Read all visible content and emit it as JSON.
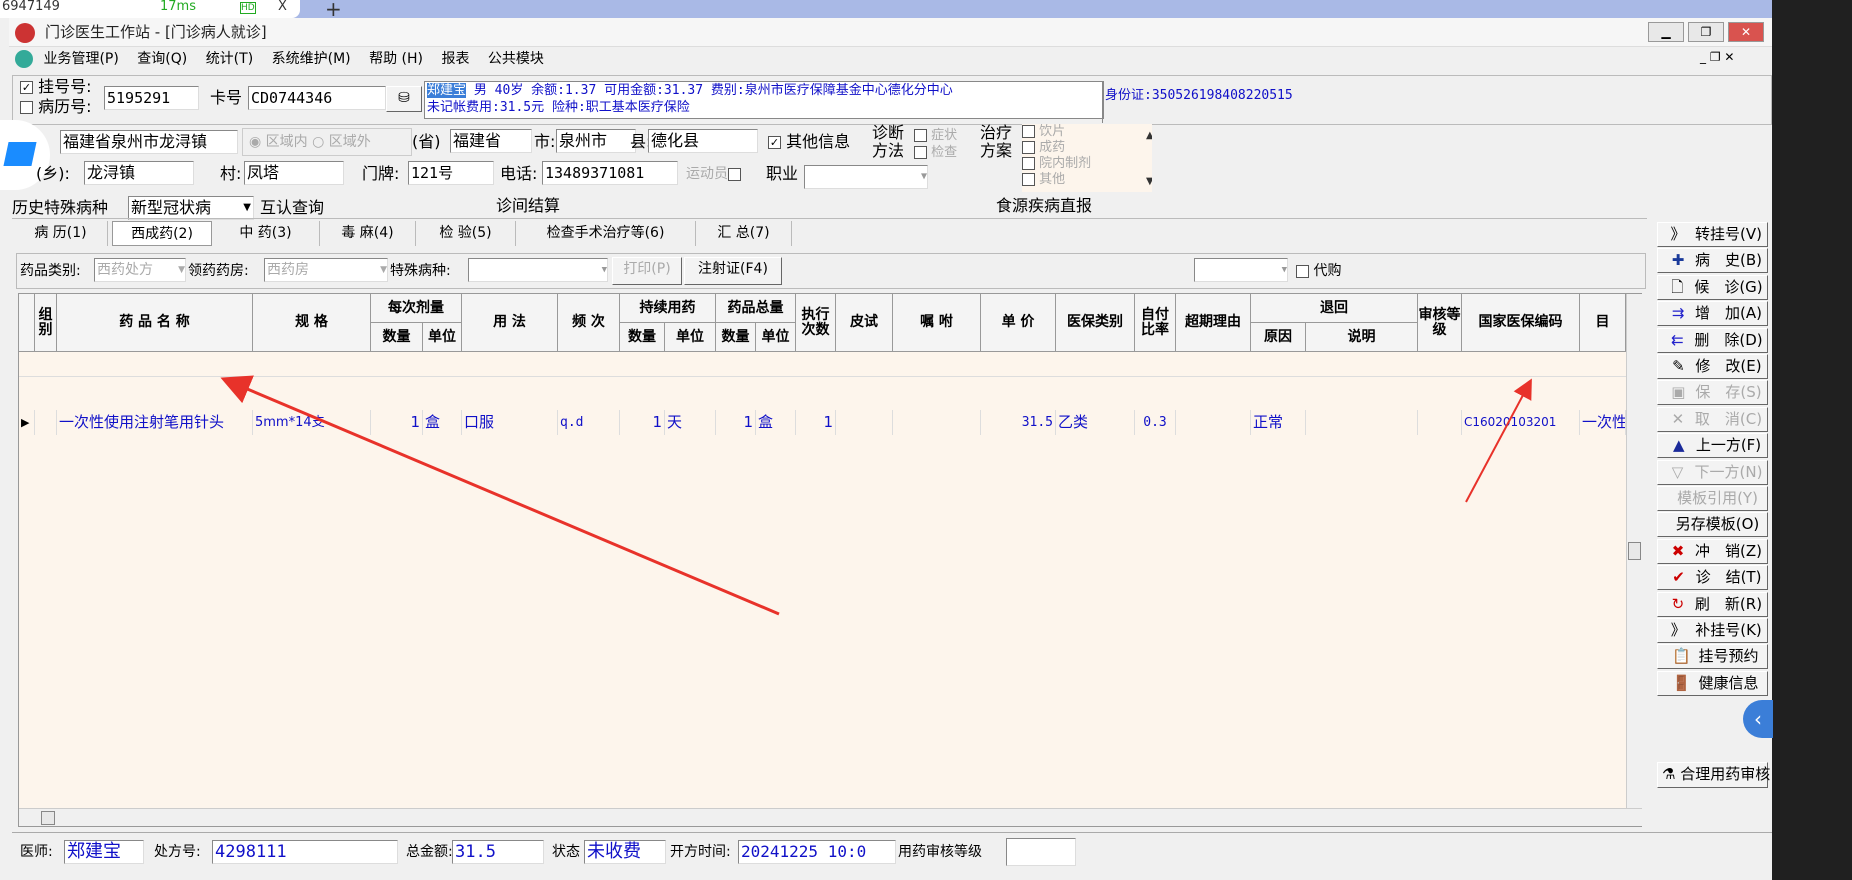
{
  "browser": {
    "tab_text": "6947149",
    "latency": "17ms",
    "hd": "HD",
    "close": "X",
    "new_tab": "+"
  },
  "window": {
    "title": "门诊医生工作站 - [门诊病人就诊]"
  },
  "menu": [
    "业务管理(P)",
    "查询(Q)",
    "统计(T)",
    "系统维护(M)",
    "帮助 (H)",
    "报表",
    "公共模块"
  ],
  "patient": {
    "reg_no_label": "挂号号:",
    "reg_no_checked": true,
    "reg_no": "5195291",
    "record_no_label": "病历号:",
    "record_no_checked": false,
    "card_label": "卡号",
    "card_no": "CD0744346",
    "info_name": "郑建宝",
    "info_line1": " 男 40岁 余额:1.37 可用金额:31.37 费别:泉州市医疗保障基金中心德化分中心",
    "info_line2": "未记帐费用:31.5元 险种:职工基本医疗保险",
    "id_card": "身份证:350526198408220515"
  },
  "address": {
    "full": "福建省泉州市龙浔镇",
    "radio_in": "区域内",
    "radio_out": "区域外",
    "province_label": "(省)",
    "province": "福建省",
    "city_label": "市:",
    "city": "泉州市",
    "county_label": "县:",
    "county": "德化县",
    "other_info_label": "其他信息",
    "other_info_checked": true,
    "town_label": "(乡):",
    "town": "龙浔镇",
    "village_label": "村:",
    "village": "凤塔",
    "door_label": "门牌:",
    "door": "121号",
    "phone_label": "电话:",
    "phone": "13489371081",
    "athlete_label": "运动员",
    "job_label": "职业",
    "diag_method_label": "诊断方法",
    "diag_opts": [
      "症状",
      "检查"
    ],
    "treat_plan_label": "治疗方案",
    "treat_opts": [
      "饮片",
      "成药",
      "院内制剂",
      "其他"
    ],
    "history_label": "历史特殊病种",
    "history_value": "新型冠状病",
    "mutual_query": "互认查询",
    "clinic_settle": "诊间结算",
    "food_report": "食源疾病直报"
  },
  "tabs": [
    "病 历(1)",
    "西成药(2)",
    "中 药(3)",
    "毒 麻(4)",
    "检 验(5)",
    "检查手术治疗等(6)",
    "汇 总(7)"
  ],
  "active_tab": 1,
  "filter": {
    "category_label": "药品类别:",
    "category": "西药处方",
    "pharmacy_label": "领药药房:",
    "pharmacy": "西药房",
    "special_label": "特殊病种:",
    "special": "",
    "print": "打印(P)",
    "injection": "注射证(F4)",
    "proxy_label": "代购"
  },
  "grid": {
    "headers": {
      "group": "组别",
      "name": "药 品 名 称",
      "spec": "规 格",
      "dose": "每次剂量",
      "qty": "数量",
      "unit": "单位",
      "usage": "用 法",
      "freq": "频 次",
      "duration": "持续用药",
      "total": "药品总量",
      "exec": "执行次数",
      "skin": "皮试",
      "note": "嘱 咐",
      "price": "单 价",
      "ins_type": "医保类别",
      "self_ratio": "自付比率",
      "overdue": "超期理由",
      "return": "退回",
      "reason": "原因",
      "desc": "说明",
      "audit": "审核等级",
      "code": "国家医保编码",
      "last": "目"
    },
    "rows": [
      {
        "name": "一次性使用注射笔用针头",
        "spec": "5mm*14支",
        "dose_qty": "1",
        "dose_unit": "盒",
        "usage": "口服",
        "freq": "q.d",
        "dur_qty": "1",
        "dur_unit": "天",
        "total_qty": "1",
        "total_unit": "盒",
        "exec": "1",
        "skin": "",
        "note": "",
        "price": "31.5",
        "ins_type": "乙类",
        "self_ratio": "0.3",
        "overdue": "",
        "reason": "正常",
        "desc": "",
        "audit": "",
        "code": "C16020103201",
        "last": "一次性"
      }
    ]
  },
  "side_buttons": [
    {
      "label": "转挂号(V)",
      "icon": "double-chevron-icon",
      "enabled": true
    },
    {
      "label": "病　史(B)",
      "icon": "plus-icon",
      "enabled": true
    },
    {
      "label": "候　诊(G)",
      "icon": "document-icon",
      "enabled": true
    },
    {
      "label": "增　加(A)",
      "icon": "add-row-icon",
      "enabled": true
    },
    {
      "label": "删　除(D)",
      "icon": "delete-row-icon",
      "enabled": true
    },
    {
      "label": "修　改(E)",
      "icon": "edit-icon",
      "enabled": true
    },
    {
      "label": "保　存(S)",
      "icon": "save-icon",
      "enabled": false
    },
    {
      "label": "取　消(C)",
      "icon": "cancel-icon",
      "enabled": false
    },
    {
      "label": "上一方(F)",
      "icon": "up-arrow-icon",
      "enabled": true
    },
    {
      "label": "下一方(N)",
      "icon": "down-arrow-icon",
      "enabled": false
    },
    {
      "label": "模板引用(Y)",
      "icon": "",
      "enabled": false
    },
    {
      "label": "另存模板(O)",
      "icon": "",
      "enabled": true
    },
    {
      "label": "冲　销(Z)",
      "icon": "x-mark-icon",
      "enabled": true
    },
    {
      "label": "诊　结(T)",
      "icon": "check-icon",
      "enabled": true
    },
    {
      "label": "刷　新(R)",
      "icon": "refresh-icon",
      "enabled": true
    },
    {
      "label": "补挂号(K)",
      "icon": "double-chevron-icon",
      "enabled": true
    },
    {
      "label": "挂号预约",
      "icon": "clipboard-icon",
      "enabled": true
    },
    {
      "label": "健康信息",
      "icon": "door-icon",
      "enabled": true
    }
  ],
  "rational_drug": "合理用药审核",
  "status": {
    "doctor_label": "医师:",
    "doctor": "郑建宝",
    "rx_label": "处方号:",
    "rx_no": "4298111",
    "total_label": "总金额:",
    "total": "31.5",
    "state_label": "状态",
    "state": "未收费",
    "time_label": "开方时间:",
    "time": "20241225 10:0",
    "audit_label": "用药审核等级",
    "audit": ""
  },
  "colors": {
    "blue_text": "#1010c8",
    "grid_bg": "#fdf5ec",
    "arrow": "#e8322a",
    "highlight": "#3b7ed8"
  }
}
